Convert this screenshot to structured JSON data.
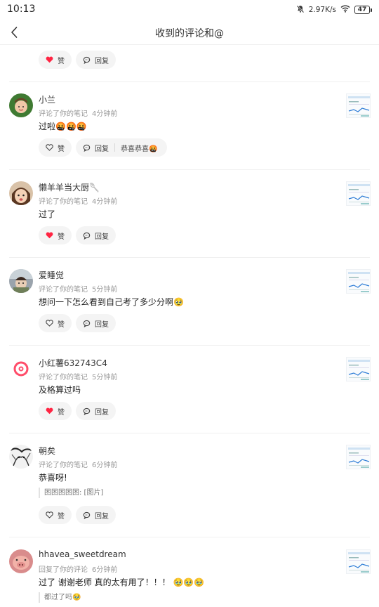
{
  "status_bar": {
    "time": "10:13",
    "network_speed": "2.97K/s",
    "battery": "47"
  },
  "header": {
    "title": "收到的评论和@"
  },
  "top_partial": {
    "like_label": "赞",
    "reply_label": "回复"
  },
  "items": [
    {
      "name": "小兰",
      "action": "评论了你的笔记",
      "time": "4分钟前",
      "comment": "过啦🤬🤬🤬",
      "like_label": "赞",
      "liked": false,
      "reply_label": "回复",
      "quick_reply": "恭喜恭喜🤬"
    },
    {
      "name": "懒羊羊当大厨🥄",
      "action": "评论了你的笔记",
      "time": "4分钟前",
      "comment": "过了",
      "like_label": "赞",
      "liked": true,
      "reply_label": "回复"
    },
    {
      "name": "爱睡觉",
      "action": "评论了你的笔记",
      "time": "5分钟前",
      "comment": "想问一下怎么看到自己考了多少分啊🥹",
      "like_label": "赞",
      "liked": false,
      "reply_label": "回复"
    },
    {
      "name": "小红薯632743C4",
      "action": "评论了你的笔记",
      "time": "5分钟前",
      "comment": "及格算过吗",
      "like_label": "赞",
      "liked": true,
      "reply_label": "回复"
    },
    {
      "name": "朝矣",
      "action": "评论了你的笔记",
      "time": "6分钟前",
      "comment": "恭喜呀!",
      "quote": "困困困困困: [图片]",
      "like_label": "赞",
      "liked": false,
      "reply_label": "回复"
    },
    {
      "name": "hhavea_sweetdream",
      "action": "回复了你的评论",
      "time": "6分钟前",
      "comment": "过了 谢谢老师 真的太有用了！！！ 🥹🥹🥹",
      "quote": "都过了吗🥹"
    }
  ],
  "colors": {
    "like_red": "#ff2442",
    "pill_bg": "#f4f4f4",
    "meta_gray": "#999999"
  }
}
